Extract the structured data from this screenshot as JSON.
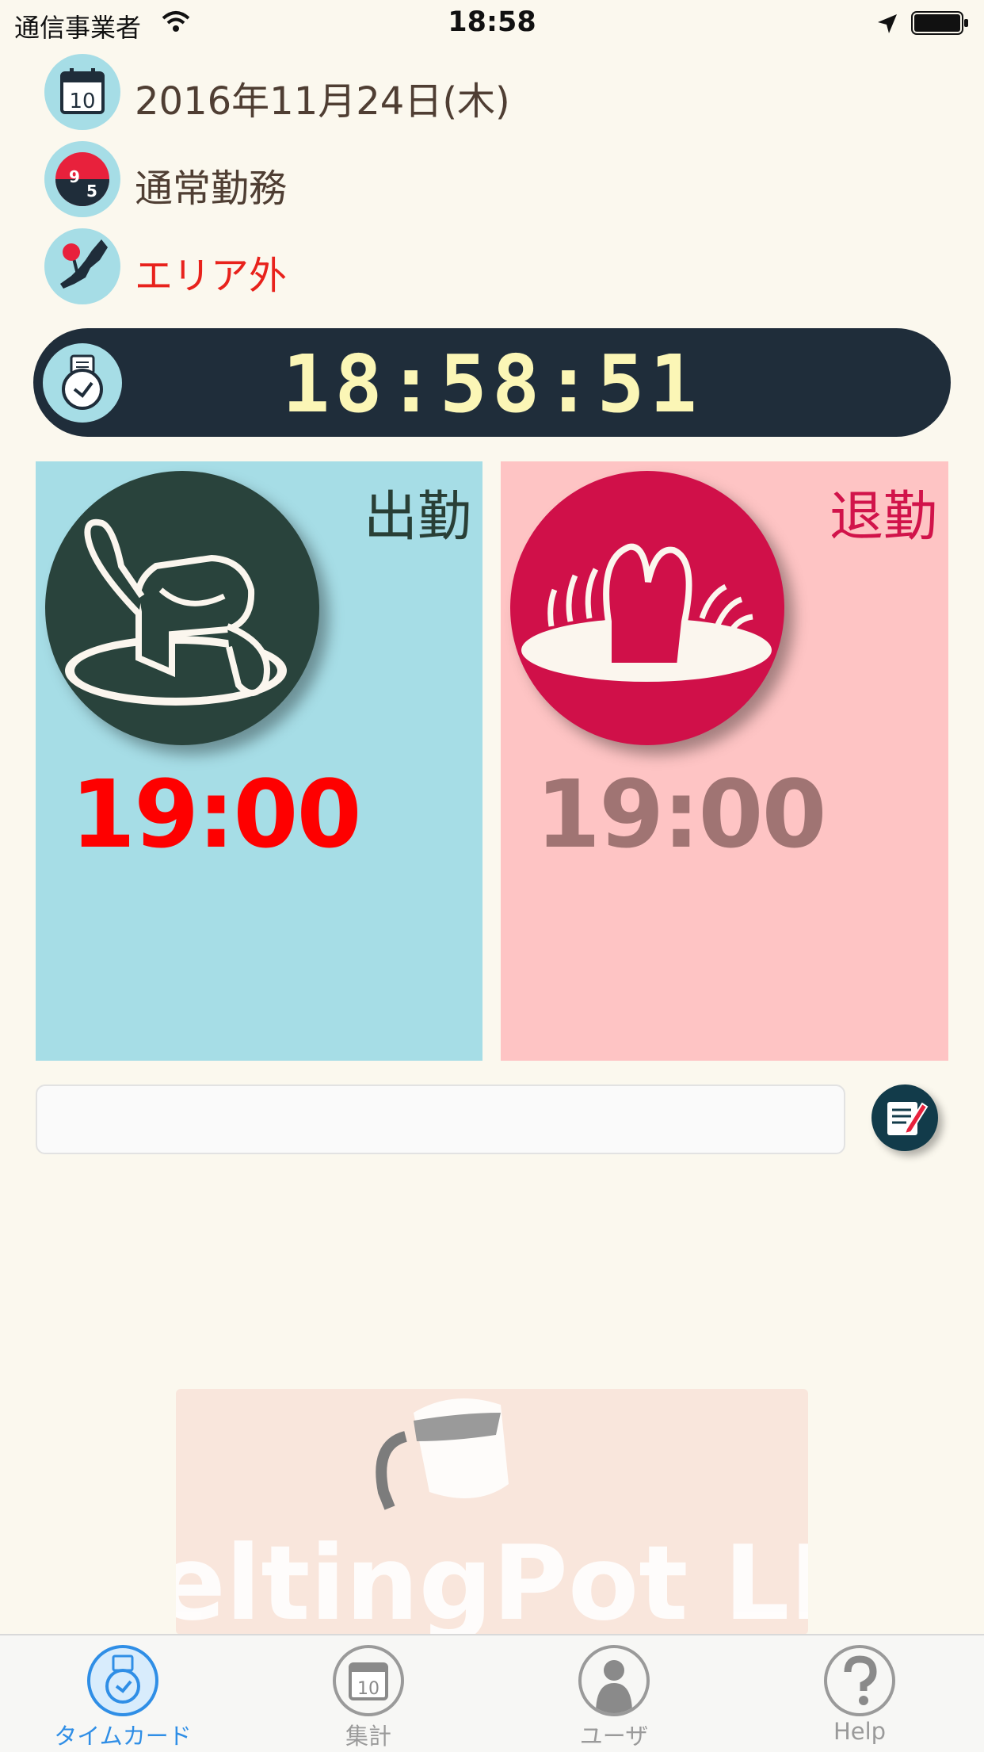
{
  "status_bar": {
    "carrier": "通信事業者",
    "time": "18:58"
  },
  "info": {
    "date": "2016年11月24日(木)",
    "calendar_day": "10",
    "shift_badge": "9-5",
    "shift": "通常勤務",
    "area": "エリア外"
  },
  "clock": {
    "time": "18:58:51"
  },
  "punch_in": {
    "label": "出勤",
    "time": "19:00"
  },
  "punch_out": {
    "label": "退勤",
    "time": "19:00"
  },
  "memo": {
    "value": ""
  },
  "logo": {
    "text": "MeltingPot LLC"
  },
  "tabs": [
    {
      "label": "タイムカード"
    },
    {
      "label": "集計",
      "icon_text": "10"
    },
    {
      "label": "ユーザ"
    },
    {
      "label": "Help"
    }
  ],
  "colors": {
    "background": "#fbf8ee",
    "clock_bar": "#1f2d3a",
    "clock_digits": "#fbf6b6",
    "punch_in_panel": "#a6dde6",
    "punch_out_panel": "#fec4c4",
    "punch_in_time": "#fe0000",
    "punch_out_time": "#a07473",
    "tab_active": "#2f8ee6"
  }
}
